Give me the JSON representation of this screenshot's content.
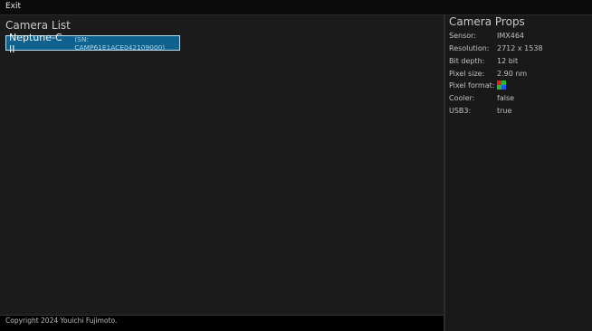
{
  "menu": {
    "exit_label": "Exit"
  },
  "camera_list": {
    "title": "Camera List",
    "items": [
      {
        "name": "Neptune-C II",
        "serial": "(SN: CAMP61E1ACE042109000)"
      }
    ]
  },
  "camera_props": {
    "title": "Camera Props",
    "rows": [
      {
        "label": "Sensor:",
        "value": "IMX464"
      },
      {
        "label": "Resolution:",
        "value": "2712 x 1538"
      },
      {
        "label": "Bit depth:",
        "value": "12 bit"
      },
      {
        "label": "Pixel size:",
        "value": "2.90 nm"
      },
      {
        "label": "Pixel format:",
        "value": ""
      },
      {
        "label": "Cooler:",
        "value": "false"
      },
      {
        "label": "USB3:",
        "value": "true"
      }
    ],
    "pixel_format_icon": "bayer-rggb-icon",
    "bayer_colors": [
      "#e22222",
      "#22c022",
      "#22c022",
      "#2255ff"
    ]
  },
  "footer": {
    "copyright": "Copyright 2024 Youichi Fujimoto."
  },
  "colors": {
    "selection_bg": "#10628e",
    "selection_border": "#b8dcf0",
    "pane_bg": "#1b1b1b"
  }
}
